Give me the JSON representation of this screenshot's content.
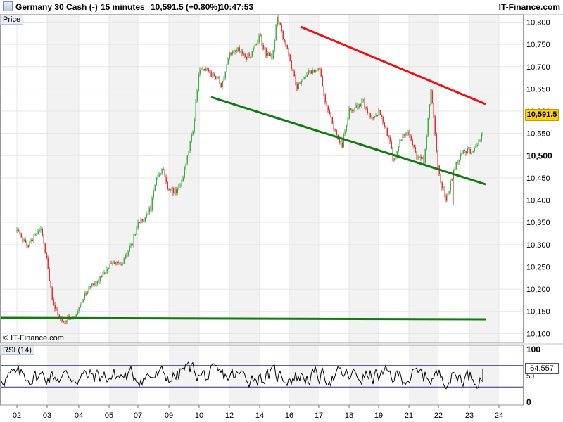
{
  "header": {
    "instrument": "Germany 30 Cash (-)",
    "timeframe": "15 minutes",
    "last": "10,591.5 (+0.80%)",
    "time": "10:47:53",
    "brand": "IT-Finance.com"
  },
  "price_panel": {
    "label": "Price",
    "copyright": "© IT-Finance.com",
    "last_tag": "10,591.5"
  },
  "rsi_panel": {
    "label": "RSI (14)",
    "last_tag": "64.557"
  },
  "colors": {
    "up": "#3cb043",
    "down": "#e03030",
    "resistance": "#ee1111",
    "support": "#117a11",
    "rsi": "#000000",
    "bands": "#2a2a8a",
    "grid": "#e6e6e6",
    "stripe": "#f2f2f2"
  },
  "chart_data": [
    {
      "type": "candlestick",
      "title": "Germany 30 Cash (-)",
      "timeframe": "15 minutes",
      "x_tick_labels": [
        "02",
        "03",
        "04",
        "05",
        "07",
        "09",
        "10",
        "12",
        "14",
        "16",
        "17",
        "18",
        "19",
        "21",
        "22",
        "23",
        "24"
      ],
      "y_ticks": [
        10100,
        10150,
        10200,
        10250,
        10300,
        10350,
        10400,
        10450,
        10500,
        10550,
        10600,
        10650,
        10700,
        10750,
        10800
      ],
      "y_tick_labels": [
        "10,100",
        "10,150",
        "10,200",
        "10,250",
        "10,300",
        "10,350",
        "10,400",
        "10,450",
        "10,500",
        "10,550",
        "10,600",
        "10,650",
        "10,700",
        "10,750",
        "10,800"
      ],
      "y_emphasized_tick": "10,500",
      "ylim": [
        10080,
        10815
      ],
      "last_price": 10591.5,
      "change_pct": 0.8,
      "path": [
        [
          "02",
          10330
        ],
        [
          "02",
          10310
        ],
        [
          "02",
          10300
        ],
        [
          "02",
          10320
        ],
        [
          "02",
          10330
        ],
        [
          "03",
          10260
        ],
        [
          "03",
          10170
        ],
        [
          "03",
          10140
        ],
        [
          "03",
          10120
        ],
        [
          "03",
          10140
        ],
        [
          "03",
          10130
        ],
        [
          "04",
          10160
        ],
        [
          "04",
          10190
        ],
        [
          "04",
          10210
        ],
        [
          "04",
          10220
        ],
        [
          "04",
          10230
        ],
        [
          "05",
          10250
        ],
        [
          "05",
          10260
        ],
        [
          "05",
          10250
        ],
        [
          "05",
          10280
        ],
        [
          "05",
          10300
        ],
        [
          "07",
          10350
        ],
        [
          "07",
          10360
        ],
        [
          "07",
          10380
        ],
        [
          "07",
          10450
        ],
        [
          "07",
          10470
        ],
        [
          "09",
          10420
        ],
        [
          "09",
          10420
        ],
        [
          "09",
          10430
        ],
        [
          "09",
          10500
        ],
        [
          "09",
          10560
        ],
        [
          "10",
          10700
        ],
        [
          "10",
          10690
        ],
        [
          "10",
          10680
        ],
        [
          "10",
          10660
        ],
        [
          "12",
          10730
        ],
        [
          "12",
          10740
        ],
        [
          "12",
          10720
        ],
        [
          "12",
          10730
        ],
        [
          "14",
          10770
        ],
        [
          "14",
          10730
        ],
        [
          "14",
          10720
        ],
        [
          "14",
          10810
        ],
        [
          "14",
          10760
        ],
        [
          "16",
          10720
        ],
        [
          "16",
          10650
        ],
        [
          "16",
          10680
        ],
        [
          "16",
          10690
        ],
        [
          "17",
          10700
        ],
        [
          "17",
          10610
        ],
        [
          "17",
          10560
        ],
        [
          "17",
          10520
        ],
        [
          "18",
          10600
        ],
        [
          "18",
          10610
        ],
        [
          "18",
          10620
        ],
        [
          "18",
          10580
        ],
        [
          "19",
          10600
        ],
        [
          "19",
          10560
        ],
        [
          "19",
          10490
        ],
        [
          "19",
          10540
        ],
        [
          "21",
          10550
        ],
        [
          "21",
          10500
        ],
        [
          "21",
          10490
        ],
        [
          "21",
          10650
        ],
        [
          "22",
          10460
        ],
        [
          "22",
          10400
        ],
        [
          "22",
          10470
        ],
        [
          "22",
          10510
        ],
        [
          "23",
          10510
        ],
        [
          "23",
          10520
        ],
        [
          "23",
          10560
        ],
        [
          "23",
          10591.5
        ]
      ],
      "trendlines": [
        {
          "name": "Resistance",
          "color": "#ee1111",
          "from": [
            "14",
            10810
          ],
          "to": [
            "23",
            10617
          ]
        },
        {
          "name": "Support",
          "color": "#117a11",
          "from": [
            "10",
            10630
          ],
          "to": [
            "23",
            10420
          ]
        },
        {
          "name": "Horizontal support",
          "color": "#117a11",
          "from": [
            "02",
            10100
          ],
          "to": [
            "23",
            10100
          ]
        }
      ]
    },
    {
      "type": "line",
      "title": "RSI (14)",
      "ylim": [
        0,
        100
      ],
      "y_tick_labels": [
        "100",
        "50",
        "0"
      ],
      "bands": [
        30,
        70
      ],
      "last_value": 64.557
    }
  ]
}
